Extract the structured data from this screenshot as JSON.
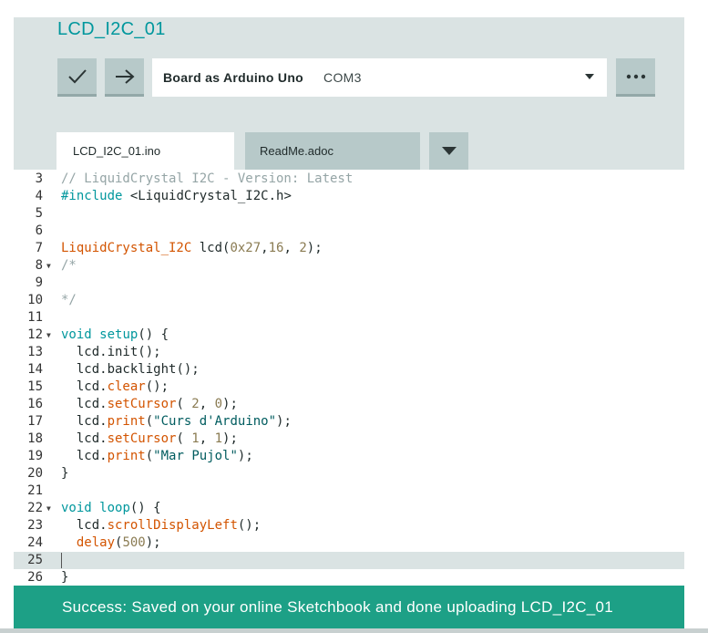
{
  "sketch": {
    "title": "LCD_I2C_01"
  },
  "toolbar": {
    "verify_icon": "checkmark-icon",
    "upload_icon": "arrow-right-icon",
    "more_icon": "ellipsis-icon",
    "board": "Board as Arduino Uno",
    "port": "COM3"
  },
  "tabs": [
    {
      "label": "LCD_I2C_01.ino",
      "active": true
    },
    {
      "label": "ReadMe.adoc",
      "active": false
    }
  ],
  "editor": {
    "active_line": 25,
    "lines": [
      {
        "num": "3",
        "text": "// LiquidCrystal I2C - Version: Latest"
      },
      {
        "num": "4",
        "text": "#include <LiquidCrystal_I2C.h>"
      },
      {
        "num": "5",
        "text": ""
      },
      {
        "num": "6",
        "text": ""
      },
      {
        "num": "7",
        "text": "LiquidCrystal_I2C lcd(0x27,16, 2);"
      },
      {
        "num": "8",
        "text": "/*",
        "fold": true
      },
      {
        "num": "9",
        "text": ""
      },
      {
        "num": "10",
        "text": "*/"
      },
      {
        "num": "11",
        "text": ""
      },
      {
        "num": "12",
        "text": "void setup() {",
        "fold": true
      },
      {
        "num": "13",
        "text": "  lcd.init();"
      },
      {
        "num": "14",
        "text": "  lcd.backlight();"
      },
      {
        "num": "15",
        "text": "  lcd.clear();"
      },
      {
        "num": "16",
        "text": "  lcd.setCursor( 2, 0);"
      },
      {
        "num": "17",
        "text": "  lcd.print(\"Curs d'Arduino\");"
      },
      {
        "num": "18",
        "text": "  lcd.setCursor( 1, 1);"
      },
      {
        "num": "19",
        "text": "  lcd.print(\"Mar Pujol\");"
      },
      {
        "num": "20",
        "text": "}"
      },
      {
        "num": "21",
        "text": ""
      },
      {
        "num": "22",
        "text": "void loop() {",
        "fold": true
      },
      {
        "num": "23",
        "text": "  lcd.scrollDisplayLeft();"
      },
      {
        "num": "24",
        "text": "  delay(500);"
      },
      {
        "num": "25",
        "text": ""
      },
      {
        "num": "26",
        "text": "}"
      }
    ]
  },
  "status": {
    "message": "Success: Saved on your online Sketchbook and done uploading LCD_I2C_01"
  },
  "colors": {
    "accent": "#00979d",
    "header_bg": "#dae3e3",
    "button_bg": "#b7c9c9",
    "success": "#1da086"
  }
}
